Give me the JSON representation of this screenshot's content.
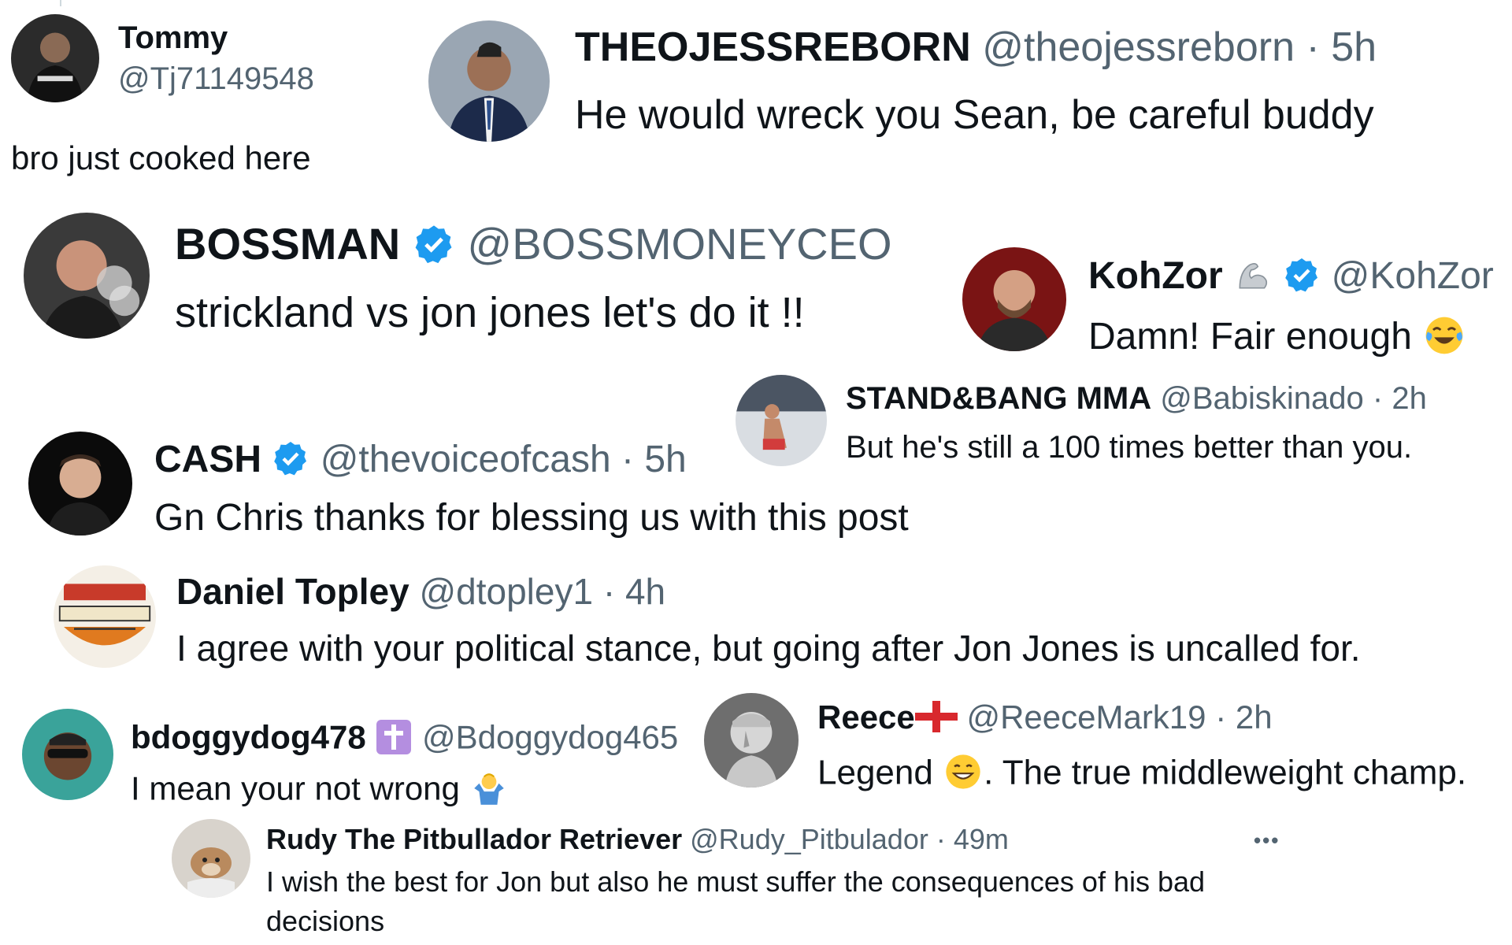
{
  "colors": {
    "text": "#0f1419",
    "secondary": "#536471",
    "verified": "#1d9bf0",
    "cross_badge": "#b48ee0"
  },
  "tweets": [
    {
      "name": "Tommy",
      "handle": "@Tj71149548",
      "time": "",
      "text": "bro just cooked here",
      "avatar": "fighter-avatar"
    },
    {
      "name": "THEOJESSREBORN",
      "handle": "@theojessreborn",
      "time": "5h",
      "text": "He would wreck you Sean, be careful buddy",
      "avatar": "man-in-suit-avatar"
    },
    {
      "name": "BOSSMAN",
      "handle": "@BOSSMONEYCEO",
      "time": "",
      "text": "strickland vs jon jones let's do it !!",
      "avatar": "smoking-man-avatar",
      "verified": true
    },
    {
      "name": "KohZor",
      "handle": "@KohZor",
      "time": "",
      "text": "Damn! Fair enough",
      "avatar": "bearded-man-avatar",
      "verified": true,
      "name_emoji": "flexed-biceps-icon",
      "text_emoji": "tears-of-joy-icon"
    },
    {
      "name": "STAND&BANG MMA",
      "handle": "@Babiskinado",
      "time": "2h",
      "text": "But he's still a 100 times better than you.",
      "avatar": "octagon-fight-avatar"
    },
    {
      "name": "CASH",
      "handle": "@thevoiceofcash",
      "time": "5h",
      "text": "Gn Chris thanks for blessing us with this post",
      "avatar": "smiling-man-avatar",
      "verified": true
    },
    {
      "name": "Daniel Topley",
      "handle": "@dtopley1",
      "time": "4h",
      "text": "I agree with your political stance, but going after Jon Jones is uncalled for.",
      "avatar": "tournament-logo-avatar"
    },
    {
      "name": "bdoggydog478",
      "handle": "@Bdoggydog465",
      "time": "",
      "text": "I mean your not wrong",
      "avatar": "sunglasses-man-avatar",
      "name_emoji": "latin-cross-icon",
      "text_emoji": "person-shrugging-icon"
    },
    {
      "name": "Reece",
      "handle": "@ReeceMark19",
      "time": "2h",
      "text": "Legend",
      "text_after_emoji": ". The true middleweight champ.",
      "avatar": "statue-bust-avatar",
      "name_emoji": "england-flag-icon",
      "text_emoji": "grinning-face-icon"
    },
    {
      "name": "Rudy The Pitbullador Retriever",
      "handle": "@Rudy_Pitbulador",
      "time": "49m",
      "text_line1": "I wish the best for Jon but also he must suffer the consequences of his bad",
      "text_line2": "decisions",
      "avatar": "dog-avatar",
      "more_label": "•••"
    }
  ]
}
